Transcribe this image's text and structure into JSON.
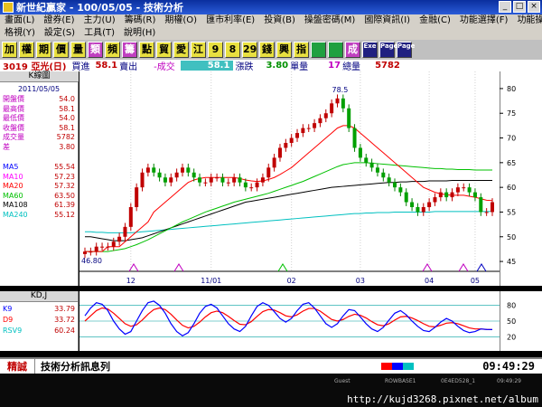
{
  "window": {
    "title": "新世紀贏家 - 100/05/05 - 技術分析"
  },
  "menu": {
    "row1": [
      "畫面(L)",
      "證券(E)",
      "主力(U)",
      "籌碼(R)",
      "期權(O)",
      "匯市利率(E)",
      "投資(B)",
      "操盤密碼(M)",
      "國際資訊(I)",
      "金融(C)",
      "功能選擇(F)",
      "功能操作(E)"
    ],
    "row2": [
      "格視(Y)",
      "設定(S)",
      "工具(T)",
      "說明(H)"
    ]
  },
  "toolbar": {
    "buttons": [
      "加",
      "權",
      "期",
      "價",
      "量",
      "類",
      "頻",
      "籌",
      "點",
      "貿",
      "愛",
      "江",
      "9",
      "8",
      "29",
      "錢",
      "興",
      "指",
      "",
      "",
      "成",
      "Exe",
      "Page",
      "Page"
    ]
  },
  "info": {
    "stock": "3019 亞光(日)",
    "buy_label": "買進",
    "buy": "58.1",
    "sell_label": "賣出",
    "trade_label": "-成交",
    "trade": "58.1",
    "change_label": "漲跌",
    "change": "3.80",
    "vol_label": "單量",
    "vol": "17",
    "total_label": "總量",
    "total": "5782"
  },
  "kchart": {
    "title": "K線圖",
    "date": "2011/05/05",
    "stats": [
      {
        "label": "開盤價",
        "value": "54.0"
      },
      {
        "label": "最高價",
        "value": "58.1"
      },
      {
        "label": "最低價",
        "value": "54.0"
      },
      {
        "label": "收盤價",
        "value": "58.1"
      },
      {
        "label": "成交量",
        "value": "5782"
      },
      {
        "label": "差",
        "value": "3.80"
      }
    ],
    "ma": [
      {
        "label": "MA5",
        "value": "55.54",
        "color": "#0000ff"
      },
      {
        "label": "MA10",
        "value": "57.23",
        "color": "#ff00ff"
      },
      {
        "label": "MA20",
        "value": "57.32",
        "color": "#ff0000"
      },
      {
        "label": "MA60",
        "value": "63.50",
        "color": "#00c000"
      },
      {
        "label": "MA108",
        "value": "61.39",
        "color": "#000000"
      },
      {
        "label": "MA240",
        "value": "55.12",
        "color": "#00c0c0"
      }
    ]
  },
  "kd": {
    "title": "KD,J",
    "items": [
      {
        "label": "K9",
        "value": "33.79",
        "color": "#0000ff"
      },
      {
        "label": "D9",
        "value": "33.72",
        "color": "#ff0000"
      },
      {
        "label": "RSV9",
        "value": "60.24",
        "color": "#00c0c0"
      }
    ]
  },
  "chart_data": {
    "type": "line",
    "x_ticks": [
      "12",
      "11/01",
      "02",
      "03",
      "04",
      "05"
    ],
    "y_ticks": [
      80,
      75,
      70,
      65,
      60,
      55,
      50,
      45
    ],
    "ylim": [
      43,
      82
    ],
    "annotations": [
      "78.5",
      "46.80"
    ],
    "kd_y_ticks": [
      80,
      50,
      20
    ],
    "kd_ylim": [
      0,
      100
    ],
    "close": [
      47,
      47,
      48,
      48,
      48,
      49,
      50,
      52,
      56,
      60,
      63,
      64,
      63,
      62,
      61,
      62,
      63,
      64,
      63,
      62,
      61,
      61,
      62,
      62,
      61,
      61,
      62,
      61,
      60,
      60,
      61,
      62,
      64,
      66,
      68,
      69,
      70,
      71,
      72,
      72,
      73,
      74,
      75,
      77,
      78,
      76,
      72,
      68,
      66,
      65,
      64,
      63,
      62,
      61,
      60,
      59,
      57,
      56,
      55,
      56,
      57,
      58,
      59,
      58,
      59,
      60,
      60,
      59,
      58,
      55,
      55,
      57
    ],
    "ma20": [
      47,
      47,
      47,
      47,
      48,
      48,
      48,
      49,
      50,
      51,
      52,
      53,
      55,
      56,
      57,
      58,
      59,
      60,
      61,
      61.5,
      61.8,
      62,
      62,
      62,
      62,
      62,
      62,
      61.8,
      61.5,
      61.3,
      61.2,
      61.3,
      61.6,
      62,
      62.6,
      63.3,
      64,
      65,
      66,
      67,
      68,
      69,
      70,
      71,
      72,
      72.5,
      72.5,
      72,
      71,
      70,
      69,
      68,
      67,
      66,
      65,
      64,
      63,
      62,
      61,
      60,
      59.5,
      59,
      58.7,
      58.5,
      58.4,
      58.4,
      58.4,
      58.2,
      58,
      57.7,
      57.4,
      57.32
    ],
    "ma60": [
      47,
      47,
      47,
      47,
      47,
      47.2,
      47.4,
      47.6,
      48,
      48.4,
      48.9,
      49.4,
      50,
      50.6,
      51.2,
      51.8,
      52.4,
      53,
      53.5,
      54,
      54.5,
      55,
      55.4,
      55.8,
      56.2,
      56.6,
      57,
      57.3,
      57.6,
      57.9,
      58.2,
      58.5,
      58.8,
      59.2,
      59.6,
      60,
      60.4,
      60.8,
      61.2,
      61.7,
      62.2,
      62.7,
      63.2,
      63.7,
      64.2,
      64.6,
      64.8,
      65,
      65,
      65,
      64.9,
      64.8,
      64.7,
      64.6,
      64.5,
      64.4,
      64.3,
      64.2,
      64.1,
      64,
      63.9,
      63.8,
      63.8,
      63.7,
      63.7,
      63.6,
      63.6,
      63.6,
      63.5,
      63.5,
      63.5,
      63.5
    ],
    "ma240": [
      51,
      51,
      50.9,
      50.9,
      50.8,
      50.8,
      50.8,
      50.8,
      50.8,
      50.9,
      51,
      51.1,
      51.2,
      51.3,
      51.4,
      51.5,
      51.6,
      51.7,
      51.8,
      51.9,
      52,
      52.1,
      52.2,
      52.3,
      52.4,
      52.5,
      52.6,
      52.7,
      52.8,
      52.9,
      53,
      53.1,
      53.2,
      53.3,
      53.4,
      53.5,
      53.6,
      53.7,
      53.8,
      53.9,
      54,
      54.1,
      54.2,
      54.3,
      54.4,
      54.5,
      54.6,
      54.7,
      54.7,
      54.8,
      54.8,
      54.9,
      54.9,
      54.9,
      55,
      55,
      55,
      55,
      55,
      55,
      55,
      55.1,
      55.1,
      55.1,
      55.1,
      55.1,
      55.1,
      55.1,
      55.1,
      55.1,
      55.1,
      55.12
    ],
    "ma108": [
      50,
      50,
      49.8,
      49.6,
      49.4,
      49.2,
      49.2,
      49.2,
      49.4,
      49.6,
      49.8,
      50.2,
      50.6,
      51,
      51.4,
      51.8,
      52.2,
      52.6,
      53,
      53.4,
      53.8,
      54.2,
      54.6,
      55,
      55.4,
      55.8,
      56.2,
      56.6,
      57,
      57.2,
      57.4,
      57.6,
      57.8,
      58,
      58.2,
      58.4,
      58.6,
      58.8,
      59,
      59.2,
      59.4,
      59.6,
      59.8,
      60,
      60.1,
      60.2,
      60.3,
      60.4,
      60.5,
      60.6,
      60.7,
      60.8,
      60.9,
      61,
      61,
      61.1,
      61.1,
      61.2,
      61.2,
      61.2,
      61.3,
      61.3,
      61.3,
      61.3,
      61.4,
      61.4,
      61.4,
      61.4,
      61.4,
      61.39,
      61.39,
      61.39
    ],
    "k": [
      60,
      75,
      85,
      82,
      70,
      50,
      35,
      25,
      30,
      50,
      70,
      85,
      88,
      80,
      65,
      45,
      30,
      22,
      28,
      45,
      65,
      78,
      82,
      75,
      60,
      45,
      35,
      30,
      40,
      60,
      78,
      85,
      80,
      68,
      55,
      48,
      55,
      70,
      82,
      85,
      75,
      60,
      45,
      38,
      45,
      60,
      72,
      70,
      58,
      45,
      35,
      30,
      38,
      52,
      65,
      70,
      62,
      50,
      40,
      32,
      30,
      38,
      48,
      55,
      50,
      40,
      32,
      28,
      30,
      35,
      34,
      33.79
    ],
    "d": [
      50,
      60,
      70,
      75,
      73,
      65,
      55,
      45,
      40,
      43,
      52,
      63,
      72,
      75,
      72,
      63,
      52,
      42,
      37,
      40,
      48,
      58,
      66,
      69,
      66,
      59,
      51,
      44,
      43,
      49,
      59,
      68,
      72,
      71,
      66,
      60,
      58,
      62,
      69,
      74,
      74,
      69,
      61,
      53,
      50,
      53,
      59,
      63,
      61,
      56,
      49,
      43,
      41,
      45,
      52,
      58,
      59,
      56,
      51,
      45,
      40,
      39,
      42,
      46,
      47,
      45,
      41,
      37,
      35,
      35,
      34,
      33.72
    ]
  },
  "status": {
    "brand": "精誠",
    "message": "技術分析訊息列",
    "time": "09:49:29",
    "colors": [
      "#ff0000",
      "#0000ff",
      "#00c0c0"
    ]
  },
  "taskbar": {
    "url": "http://kujd3268.pixnet.net/album",
    "labels": [
      "Guest",
      "ROWBASE1",
      "0E4ED528_1",
      "09:49:29"
    ]
  }
}
